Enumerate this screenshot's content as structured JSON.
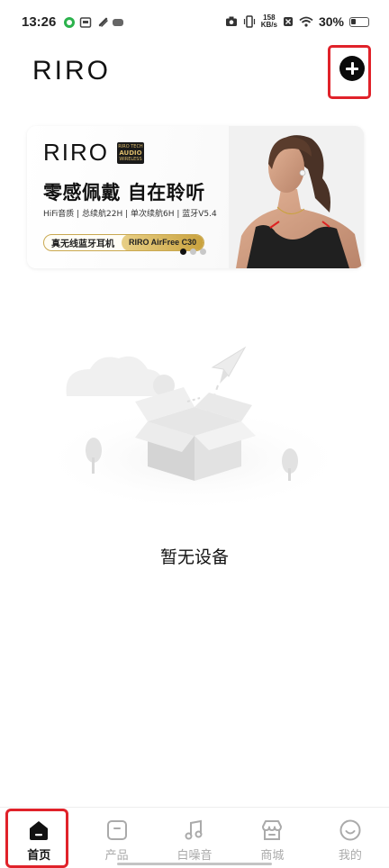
{
  "status_bar": {
    "time": "13:26",
    "net_speed_value": "158",
    "net_speed_unit": "KB/s",
    "battery": "30%"
  },
  "header": {
    "brand": "RIRO",
    "add_icon": "plus-circle-icon"
  },
  "banner": {
    "logo": "RIRO",
    "badge_top": "RIRO TECH",
    "badge_mid": "AUDIO",
    "badge_bottom": "WIRELESS",
    "headline": "零感佩戴 自在聆听",
    "specs": "HiFi音质 | 总续航22H | 单次续航6H | 蓝牙V5.4",
    "pill_label": "真无线蓝牙耳机",
    "pill_product": "RIRO AirFree C30",
    "slide_active": 1,
    "slide_count": 3
  },
  "empty_state": {
    "message": "暂无设备",
    "icon": "empty-box-icon"
  },
  "bottom_nav": {
    "items": [
      {
        "label": "首页",
        "icon": "home-icon",
        "active": true
      },
      {
        "label": "产品",
        "icon": "product-icon",
        "active": false
      },
      {
        "label": "白噪音",
        "icon": "music-note-icon",
        "active": false
      },
      {
        "label": "商城",
        "icon": "store-icon",
        "active": false
      },
      {
        "label": "我的",
        "icon": "profile-icon",
        "active": false
      }
    ]
  },
  "colors": {
    "accent_highlight": "#e0222a",
    "gold": "#c9a23e",
    "inactive": "#aaaaaa"
  }
}
